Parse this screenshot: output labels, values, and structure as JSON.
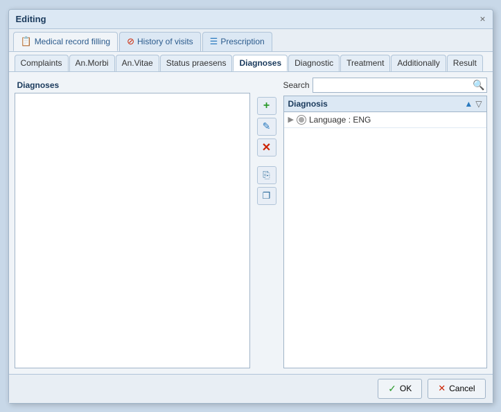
{
  "dialog": {
    "title": "Editing",
    "close_label": "×"
  },
  "main_tabs": [
    {
      "id": "medical",
      "label": "Medical record filling",
      "icon": "📋",
      "icon_type": "blue",
      "active": true
    },
    {
      "id": "history",
      "label": "History of visits",
      "icon": "🔴",
      "icon_type": "red",
      "active": false
    },
    {
      "id": "prescription",
      "label": "Prescription",
      "icon": "≡",
      "icon_type": "blue",
      "active": false
    }
  ],
  "sub_tabs": [
    {
      "id": "complaints",
      "label": "Complaints",
      "active": false
    },
    {
      "id": "anmorbi",
      "label": "An.Morbi",
      "active": false
    },
    {
      "id": "anvitae",
      "label": "An.Vitae",
      "active": false
    },
    {
      "id": "status",
      "label": "Status praesens",
      "active": false
    },
    {
      "id": "diagnoses",
      "label": "Diagnoses",
      "active": true
    },
    {
      "id": "diagnostic",
      "label": "Diagnostic",
      "active": false
    },
    {
      "id": "treatment",
      "label": "Treatment",
      "active": false
    },
    {
      "id": "additionally",
      "label": "Additionally",
      "active": false
    },
    {
      "id": "result",
      "label": "Result",
      "active": false
    }
  ],
  "left_panel": {
    "header": "Diagnoses"
  },
  "middle_buttons": [
    {
      "id": "add",
      "symbol": "+",
      "type": "plus",
      "tooltip": "Add"
    },
    {
      "id": "edit",
      "symbol": "✎",
      "type": "edit",
      "tooltip": "Edit"
    },
    {
      "id": "delete",
      "symbol": "✕",
      "type": "del",
      "tooltip": "Delete"
    },
    {
      "id": "copy1",
      "symbol": "⎘",
      "type": "copy1",
      "tooltip": "Copy 1"
    },
    {
      "id": "copy2",
      "symbol": "❐",
      "type": "copy2",
      "tooltip": "Copy 2"
    }
  ],
  "right_panel": {
    "search_label": "Search",
    "search_placeholder": "",
    "search_icon": "🔍",
    "diagnosis_column": "Diagnosis",
    "language_row": "Language : ENG"
  },
  "footer": {
    "ok_label": "OK",
    "cancel_label": "Cancel",
    "ok_icon": "✓",
    "cancel_icon": "✕"
  }
}
